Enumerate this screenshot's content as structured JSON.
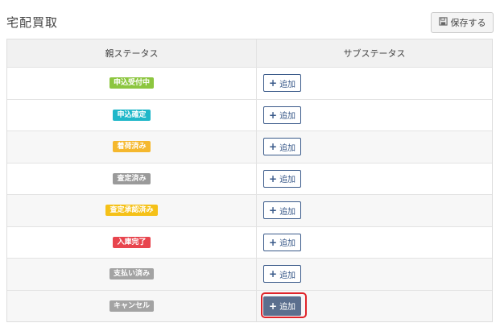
{
  "header": {
    "title": "宅配買取",
    "save_label": "保存する"
  },
  "table": {
    "columns": [
      "親ステータス",
      "サブステータス"
    ],
    "rows": [
      {
        "status": "申込受付中",
        "color": "#8cc63f",
        "button": "追加"
      },
      {
        "status": "申込確定",
        "color": "#1fb7c9",
        "button": "追加"
      },
      {
        "status": "着荷済み",
        "color": "#f5b82e",
        "button": "追加"
      },
      {
        "status": "査定済み",
        "color": "#9a9a9a",
        "button": "追加"
      },
      {
        "status": "査定承認済み",
        "color": "#f5c118",
        "button": "追加"
      },
      {
        "status": "入庫完了",
        "color": "#e8454e",
        "button": "追加"
      },
      {
        "status": "支払い済み",
        "color": "#a3a3a3",
        "button": "追加"
      },
      {
        "status": "キャンセル",
        "color": "#a3a3a3",
        "button": "追加",
        "active": true
      }
    ]
  }
}
